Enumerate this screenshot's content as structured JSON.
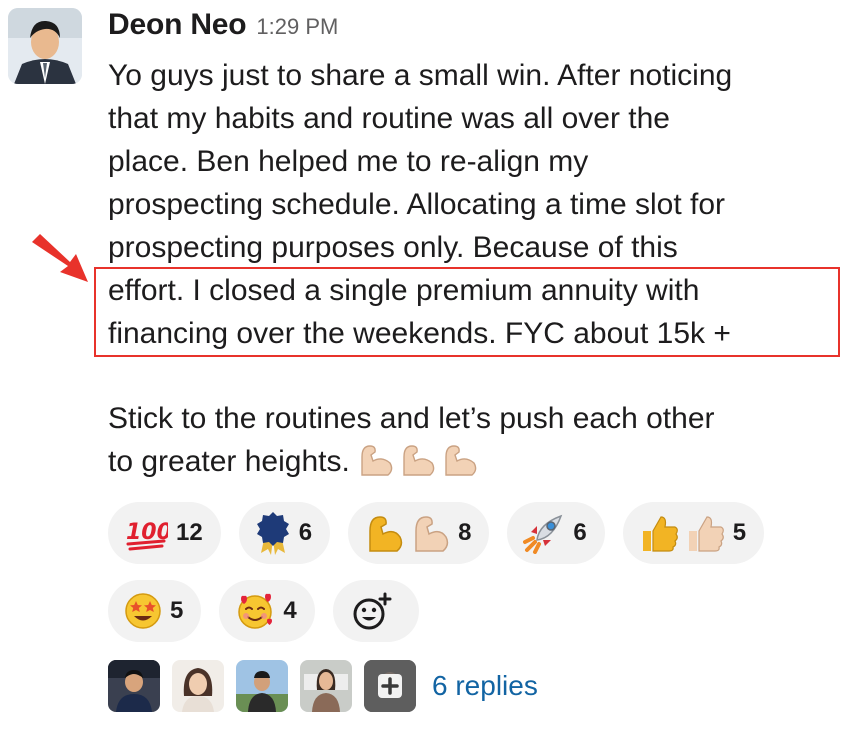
{
  "message": {
    "author": "Deon Neo",
    "timestamp": "1:29 PM",
    "paragraph1": [
      "Yo guys just to share a small win. After noticing",
      "that my habits and routine was all over the",
      "place. Ben helped me to re-align my",
      "prospecting schedule. Allocating a time slot for",
      "prospecting purposes only. Because of this",
      "effort. I closed a single premium annuity with",
      "financing over the weekends. FYC about 15k +"
    ],
    "paragraph2": [
      "Stick to the routines and let’s push each other",
      "to greater heights."
    ]
  },
  "reactions": [
    {
      "icon": "hundred-points-icon",
      "count": "12"
    },
    {
      "icon": "rosette-icon",
      "count": "6"
    },
    {
      "icon": "flexed-biceps-pair-icon",
      "count": "8"
    },
    {
      "icon": "rocket-icon",
      "count": "6"
    },
    {
      "icon": "thumbs-up-pair-icon",
      "count": "5"
    },
    {
      "icon": "star-struck-icon",
      "count": "5"
    },
    {
      "icon": "smiling-face-with-hearts-icon",
      "count": "4"
    }
  ],
  "thread": {
    "replies_label": "6 replies"
  },
  "colors": {
    "highlight": "#e8322b",
    "link": "#1264a3",
    "pill_bg": "#f2f2f2"
  }
}
